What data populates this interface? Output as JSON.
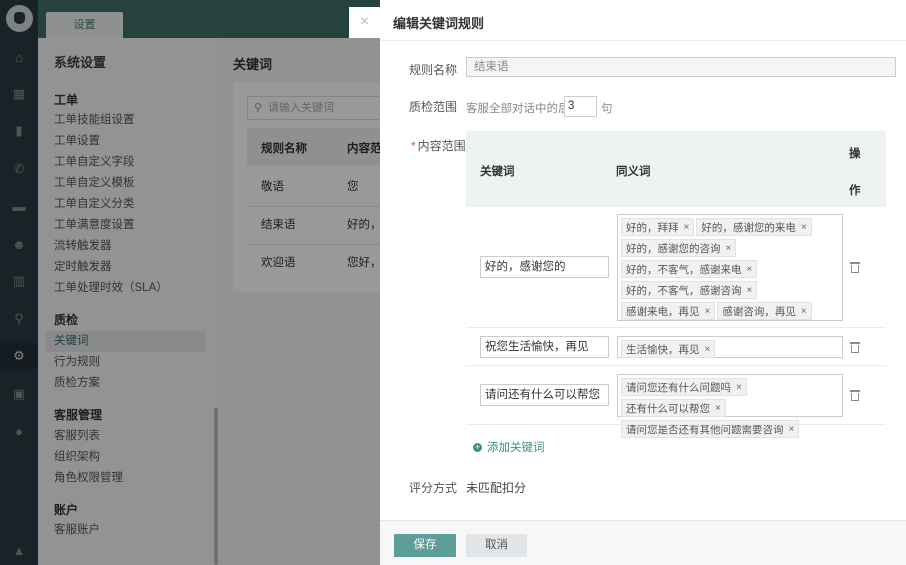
{
  "app": {
    "tab_label": "设置",
    "nav_icons": [
      "home-icon",
      "grid-icon",
      "book-icon",
      "phone-icon",
      "chat-icon",
      "contacts-icon",
      "chart-icon",
      "search-icon",
      "gear-icon",
      "monitor-icon",
      "globe-icon",
      "bell-icon"
    ]
  },
  "sidebar": {
    "title": "系统设置",
    "groups": [
      {
        "label": "工单",
        "items": [
          "工单技能组设置",
          "工单设置",
          "工单自定义字段",
          "工单自定义模板",
          "工单自定义分类",
          "工单满意度设置",
          "流转触发器",
          "定时触发器",
          "工单处理时效（SLA）"
        ]
      },
      {
        "label": "质检",
        "items": [
          "关键词",
          "行为规则",
          "质检方案"
        ]
      },
      {
        "label": "客服管理",
        "items": [
          "客服列表",
          "组织架构",
          "角色权限管理"
        ]
      },
      {
        "label": "账户",
        "items": [
          "客服账户"
        ]
      }
    ],
    "active_item": "关键词"
  },
  "main": {
    "title": "关键词",
    "search_placeholder": "请输入关键词",
    "columns": [
      "规则名称",
      "内容范"
    ],
    "rows": [
      {
        "name": "敬语",
        "content": "您"
      },
      {
        "name": "结束语",
        "content": "好的，"
      },
      {
        "name": "欢迎语",
        "content": "您好，"
      }
    ]
  },
  "modal": {
    "title": "编辑关键词规则",
    "close_glyph": "×",
    "rule_name_label": "规则名称",
    "rule_name_value": "结束语",
    "scope_label": "质检范围",
    "scope_prefix": "客服全部对话中的后",
    "scope_value": "3",
    "scope_suffix": "句",
    "content_scope_label": "内容范围",
    "required_mark": "*",
    "table_headers": {
      "keyword": "关键词",
      "synonyms": "同义词",
      "action_1": "操",
      "action_2": "作"
    },
    "keywords": [
      {
        "keyword": "好的，感谢您的",
        "synonyms": [
          "好的，拜拜",
          "好的，感谢您的来电",
          "好的，感谢您的咨询",
          "好的，不客气，感谢来电",
          "好的，不客气，感谢咨询",
          "感谢来电，再见",
          "感谢咨询，再见"
        ]
      },
      {
        "keyword": "祝您生活愉快，再见",
        "synonyms": [
          "生活愉快，再见"
        ]
      },
      {
        "keyword": "请问还有什么可以帮您",
        "synonyms": [
          "请问您还有什么问题吗",
          "还有什么可以帮您",
          "请问您是否还有其他问题需要咨询"
        ]
      }
    ],
    "add_keyword_label": "添加关键词",
    "tag_remove_glyph": "×",
    "scoring_label": "评分方式",
    "scoring_value": "未匹配扣分",
    "save_label": "保存",
    "cancel_label": "取消"
  }
}
